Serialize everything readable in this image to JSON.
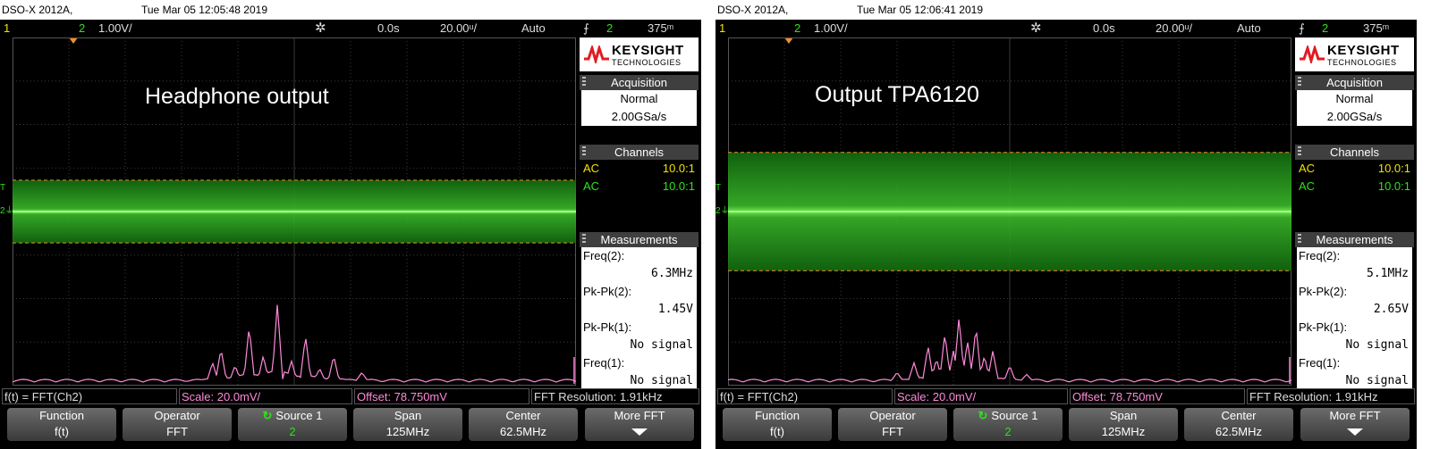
{
  "screens": [
    {
      "title_model": "DSO-X 2012A,",
      "title_datetime": "Tue Mar 05 12:05:48 2019",
      "status": {
        "ch1": "1",
        "ch2": "2",
        "ch2_scale": "1.00V/",
        "time_pos": "0.0s",
        "time_scale": "20.00ᵘ/",
        "trigger_mode": "Auto",
        "trigger_source": "2",
        "trigger_level": "375ᵐ"
      },
      "annotation": "Headphone output",
      "logo": {
        "brand": "KEYSIGHT",
        "sub": "TECHNOLOGIES"
      },
      "acquisition": {
        "header": "Acquisition",
        "mode": "Normal",
        "rate": "2.00GSa/s"
      },
      "channels": {
        "header": "Channels",
        "rows": [
          {
            "coupling": "AC",
            "probe": "10.0:1",
            "color": "#f5e200"
          },
          {
            "coupling": "AC",
            "probe": "10.0:1",
            "color": "#2ee31b"
          }
        ]
      },
      "measurements": {
        "header": "Measurements",
        "items": [
          {
            "label": "Freq(2):",
            "value": "6.3MHz"
          },
          {
            "label": "Pk-Pk(2):",
            "value": "1.45V"
          },
          {
            "label": "Pk-Pk(1):",
            "value": "No signal"
          },
          {
            "label": "Freq(1):",
            "value": "No signal"
          }
        ]
      },
      "fft": {
        "func": "f(t) = FFT(Ch2)",
        "scale": "Scale: 20.0mV/",
        "offset": "Offset: 78.750mV",
        "resolution": "FFT Resolution: 1.91kHz"
      },
      "softkeys": [
        {
          "top": "Function",
          "bottom": "f(t)"
        },
        {
          "top": "Operator",
          "bottom": "FFT"
        },
        {
          "top": "Source 1",
          "bottom": "2"
        },
        {
          "top": "Span",
          "bottom": "125MHz"
        },
        {
          "top": "Center",
          "bottom": "62.5MHz"
        },
        {
          "top": "More FFT",
          "bottom": ""
        }
      ],
      "signal_band": {
        "top_frac": 0.41,
        "bottom_frac": 0.59,
        "cursor_top_frac": 0.41,
        "cursor_bottom_frac": 0.59
      },
      "fft_peaks": [
        {
          "pos": 0.355,
          "level": 0.18
        },
        {
          "pos": 0.37,
          "level": 0.32
        },
        {
          "pos": 0.395,
          "level": 0.15
        },
        {
          "pos": 0.42,
          "level": 0.55
        },
        {
          "pos": 0.445,
          "level": 0.25
        },
        {
          "pos": 0.47,
          "level": 0.78
        },
        {
          "pos": 0.495,
          "level": 0.2
        },
        {
          "pos": 0.52,
          "level": 0.45
        },
        {
          "pos": 0.545,
          "level": 0.12
        },
        {
          "pos": 0.57,
          "level": 0.25
        },
        {
          "pos": 0.62,
          "level": 0.08
        }
      ]
    },
    {
      "title_model": "DSO-X 2012A,",
      "title_datetime": "Tue Mar 05 12:06:41 2019",
      "status": {
        "ch1": "1",
        "ch2": "2",
        "ch2_scale": "1.00V/",
        "time_pos": "0.0s",
        "time_scale": "20.00ᵘ/",
        "trigger_mode": "Auto",
        "trigger_source": "2",
        "trigger_level": "375ᵐ"
      },
      "annotation": "Output TPA6120",
      "logo": {
        "brand": "KEYSIGHT",
        "sub": "TECHNOLOGIES"
      },
      "acquisition": {
        "header": "Acquisition",
        "mode": "Normal",
        "rate": "2.00GSa/s"
      },
      "channels": {
        "header": "Channels",
        "rows": [
          {
            "coupling": "AC",
            "probe": "10.0:1",
            "color": "#f5e200"
          },
          {
            "coupling": "AC",
            "probe": "10.0:1",
            "color": "#2ee31b"
          }
        ]
      },
      "measurements": {
        "header": "Measurements",
        "items": [
          {
            "label": "Freq(2):",
            "value": "5.1MHz"
          },
          {
            "label": "Pk-Pk(2):",
            "value": "2.65V"
          },
          {
            "label": "Pk-Pk(1):",
            "value": "No signal"
          },
          {
            "label": "Freq(1):",
            "value": "No signal"
          }
        ]
      },
      "fft": {
        "func": "f(t) = FFT(Ch2)",
        "scale": "Scale: 20.0mV/",
        "offset": "Offset: 78.750mV",
        "resolution": "FFT Resolution: 1.91kHz"
      },
      "softkeys": [
        {
          "top": "Function",
          "bottom": "f(t)"
        },
        {
          "top": "Operator",
          "bottom": "FFT"
        },
        {
          "top": "Source 1",
          "bottom": "2"
        },
        {
          "top": "Span",
          "bottom": "125MHz"
        },
        {
          "top": "Center",
          "bottom": "62.5MHz"
        },
        {
          "top": "More FFT",
          "bottom": ""
        }
      ],
      "signal_band": {
        "top_frac": 0.33,
        "bottom_frac": 0.67,
        "cursor_top_frac": 0.33,
        "cursor_bottom_frac": 0.67
      },
      "fft_peaks": [
        {
          "pos": 0.3,
          "level": 0.08
        },
        {
          "pos": 0.33,
          "level": 0.18
        },
        {
          "pos": 0.355,
          "level": 0.35
        },
        {
          "pos": 0.37,
          "level": 0.22
        },
        {
          "pos": 0.385,
          "level": 0.48
        },
        {
          "pos": 0.4,
          "level": 0.3
        },
        {
          "pos": 0.41,
          "level": 0.65
        },
        {
          "pos": 0.425,
          "level": 0.4
        },
        {
          "pos": 0.44,
          "level": 0.55
        },
        {
          "pos": 0.455,
          "level": 0.25
        },
        {
          "pos": 0.47,
          "level": 0.3
        },
        {
          "pos": 0.5,
          "level": 0.15
        },
        {
          "pos": 0.53,
          "level": 0.06
        }
      ]
    }
  ]
}
